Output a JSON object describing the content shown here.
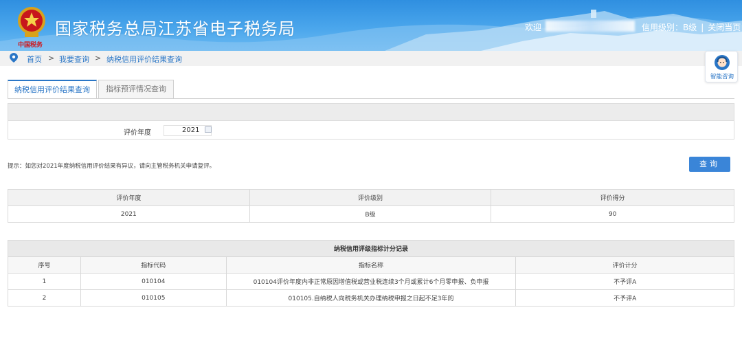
{
  "header": {
    "site_title": "国家税务总局江苏省电子税务局",
    "logo_subtitle": "中国税务",
    "welcome": "欢迎",
    "credit_level": "信用级别：B级",
    "close_page": "关闭当页"
  },
  "breadcrumb": {
    "items": [
      "首页",
      "我要查询",
      "纳税信用评价结果查询"
    ],
    "sep": ">"
  },
  "assistant": {
    "label": "智能咨询"
  },
  "tabs": [
    {
      "label": "纳税信用评价结果查询",
      "active": true
    },
    {
      "label": "指标预评情况查询",
      "active": false
    }
  ],
  "form": {
    "year_label": "评价年度",
    "year_value": "2021"
  },
  "tip": "提示：如您对2021年度纳税信用评价结果有异议，请向主管税务机关申请复评。",
  "query_button": "查询",
  "result_table": {
    "headers": [
      "评价年度",
      "评价级别",
      "评价得分"
    ],
    "row": [
      "2021",
      "B级",
      "90"
    ]
  },
  "record_table": {
    "caption": "纳税信用评级指标计分记录",
    "headers": [
      "序号",
      "指标代码",
      "指标名称",
      "评价计分"
    ],
    "rows": [
      [
        "1",
        "010104",
        "010104评价年度内非正常原因增值税或营业税连续3个月或累计6个月零申报、负申报",
        "不予评A"
      ],
      [
        "2",
        "010105",
        "010105.自纳税人向税务机关办理纳税申报之日起不足3年的",
        "不予评A"
      ]
    ]
  },
  "colors": {
    "header_blue": "#2f8fe0",
    "link_blue": "#2a76c6",
    "button_blue": "#3a85d8"
  }
}
